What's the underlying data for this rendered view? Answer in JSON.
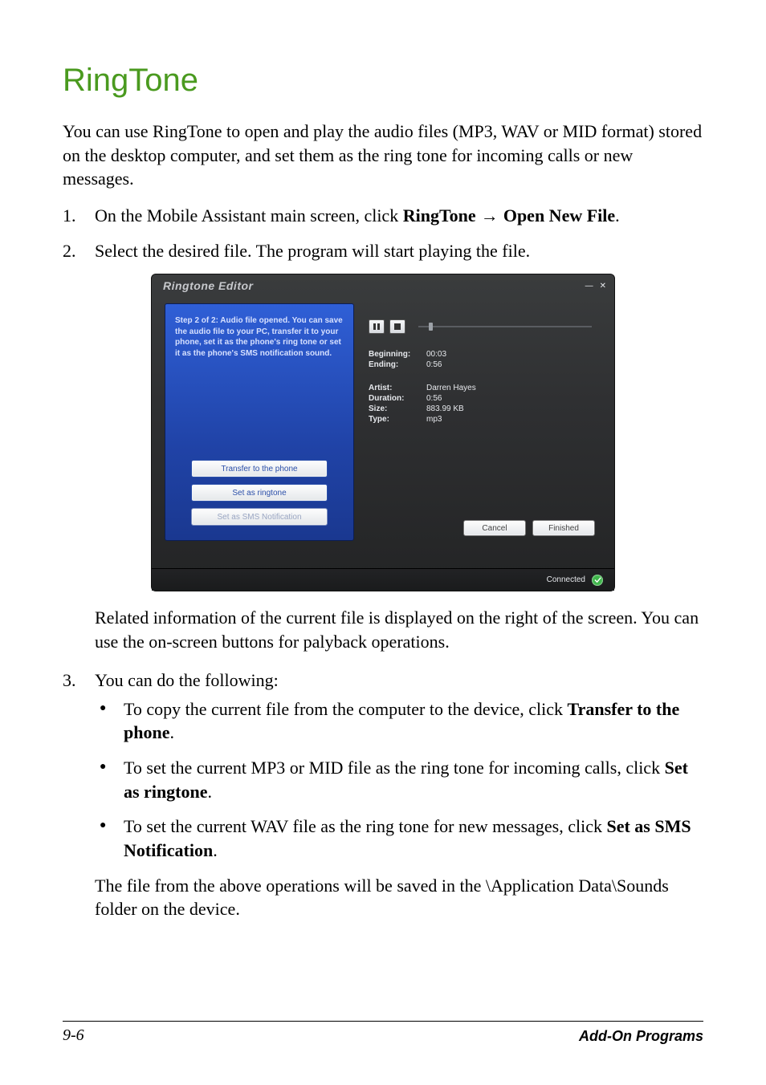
{
  "title": "RingTone",
  "intro": "You can use RingTone to open and play the audio files (MP3, WAV or MID format) stored on the desktop computer, and set them as the ring tone for incoming calls or new messages.",
  "steps": {
    "s1": {
      "num": "1.",
      "pre": "On the Mobile Assistant main screen, click ",
      "bold1": "RingTone",
      "arrow": " → ",
      "bold2": "Open New File",
      "post": "."
    },
    "s2": {
      "num": "2.",
      "text": "Select the desired file. The program will start playing the file."
    },
    "s3": {
      "num": "3.",
      "text": "You can do the following:"
    }
  },
  "after_image": "Related information of the current file is displayed on the right of the screen. You can use the on-screen buttons for palyback operations.",
  "bullets": {
    "b1": {
      "pre": "To copy the current file from the computer to the device, click ",
      "bold": "Transfer to the phone",
      "post": "."
    },
    "b2": {
      "pre": "To set the current MP3 or MID file as the ring tone for incoming calls, click ",
      "bold": "Set as ringtone",
      "post": "."
    },
    "b3": {
      "pre": "To set the current WAV file as the ring tone for new messages, click ",
      "bold": "Set as SMS Notification",
      "post": "."
    }
  },
  "trail": "The file from the above operations will be saved in the \\Application Data\\Sounds folder on the device.",
  "footer": {
    "page": "9-6",
    "section": "Add-On Programs"
  },
  "editor": {
    "window_title": "Ringtone Editor",
    "step_text": "Step 2 of 2: Audio file opened. You can save the audio file to your PC, transfer it to your phone, set it as the phone's ring tone or set it as the phone's SMS notification sound.",
    "buttons": {
      "transfer": "Transfer to the phone",
      "ringtone": "Set as ringtone",
      "sms": "Set as SMS Notification",
      "cancel": "Cancel",
      "finished": "Finished"
    },
    "info": {
      "beginning_k": "Beginning:",
      "beginning_v": "00:03",
      "ending_k": "Ending:",
      "ending_v": "0:56",
      "artist_k": "Artist:",
      "artist_v": "Darren Hayes",
      "duration_k": "Duration:",
      "duration_v": "0:56",
      "size_k": "Size:",
      "size_v": "883.99 KB",
      "type_k": "Type:",
      "type_v": "mp3"
    },
    "status": "Connected"
  }
}
